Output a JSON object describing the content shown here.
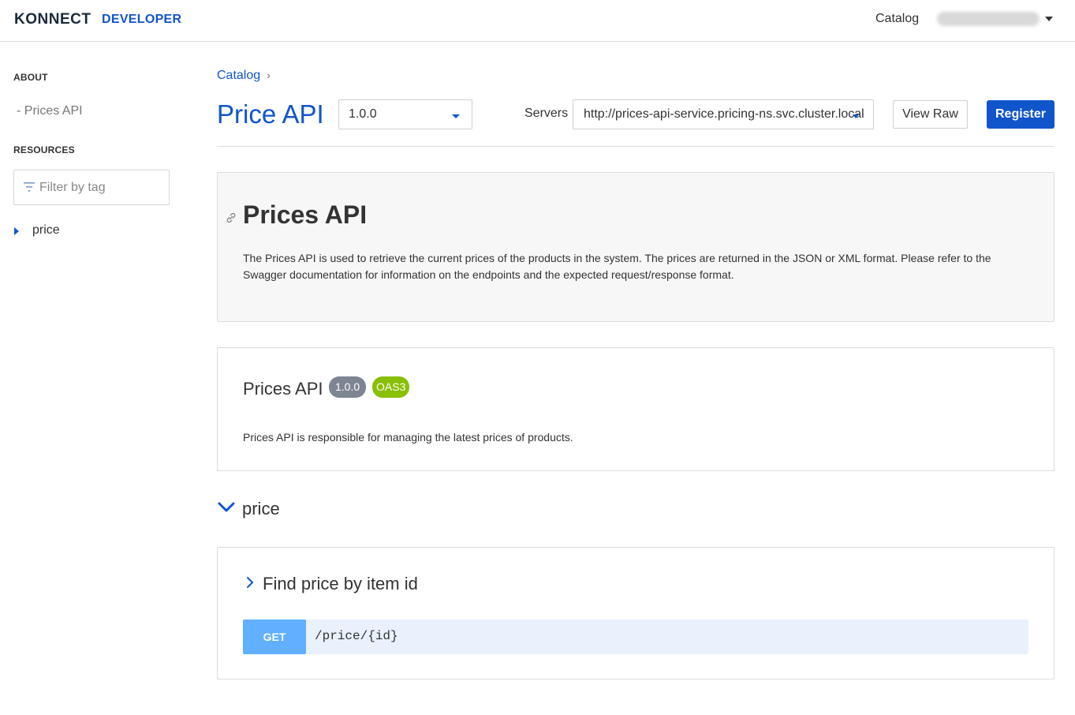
{
  "topbar": {
    "logo_main": "KONNECT",
    "logo_sub": "DEVELOPER",
    "catalog_link": "Catalog"
  },
  "sidebar": {
    "about_heading": "ABOUT",
    "about_items": [
      "-  Prices API"
    ],
    "resources_heading": "RESOURCES",
    "filter_placeholder": "Filter by tag",
    "tags": [
      "price"
    ]
  },
  "header": {
    "breadcrumb": "Catalog",
    "breadcrumb_sep": "›",
    "title": "Price API",
    "version": "1.0.0",
    "servers_label": "Servers",
    "server_url": "http://prices-api-service.pricing-ns.svc.cluster.local",
    "view_raw_label": "View Raw",
    "register_label": "Register"
  },
  "about": {
    "title": "Prices API",
    "description": "The Prices API is used to retrieve the current prices of the products in the system. The prices are returned in the JSON or XML format. Please refer to the Swagger documentation for information on the endpoints and the expected request/response format."
  },
  "info": {
    "title": "Prices API",
    "version_badge": "1.0.0",
    "oas_badge": "OAS3",
    "description": "Prices API is responsible for managing the latest prices of products."
  },
  "tag_section": {
    "label": "price"
  },
  "operation": {
    "title": "Find price by item id",
    "method": "GET",
    "path": "/price/{id}"
  },
  "colors": {
    "brand": "#1155cb",
    "get_method": "#61affe",
    "oas_badge": "#89bf04",
    "version_badge": "#7d8492"
  }
}
